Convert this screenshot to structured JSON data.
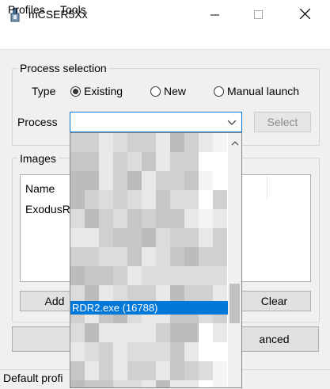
{
  "window": {
    "title": "mCSER5Xx",
    "icon": "app-icon",
    "controls": [
      "minimize-icon",
      "maximize-icon",
      "close-icon"
    ]
  },
  "menu": {
    "items": [
      "Profiles",
      "Tools"
    ]
  },
  "process_selection": {
    "title": "Process selection",
    "type_label": "Type",
    "types": [
      "Existing",
      "New",
      "Manual launch"
    ],
    "selected_type": "Existing",
    "process_label": "Process",
    "process_value": "",
    "select_button": "Select"
  },
  "images": {
    "title": "Images",
    "column_header": "Name",
    "rows": [
      "ExodusRI"
    ],
    "add_button": "Add",
    "clear_button": "Clear"
  },
  "buttons": {
    "advanced_label": "anced"
  },
  "dropdown": {
    "selected_item": "RDR2.exe (16788)"
  },
  "status": {
    "text": "Default profi"
  },
  "colors": {
    "accent": "#0078d7"
  }
}
